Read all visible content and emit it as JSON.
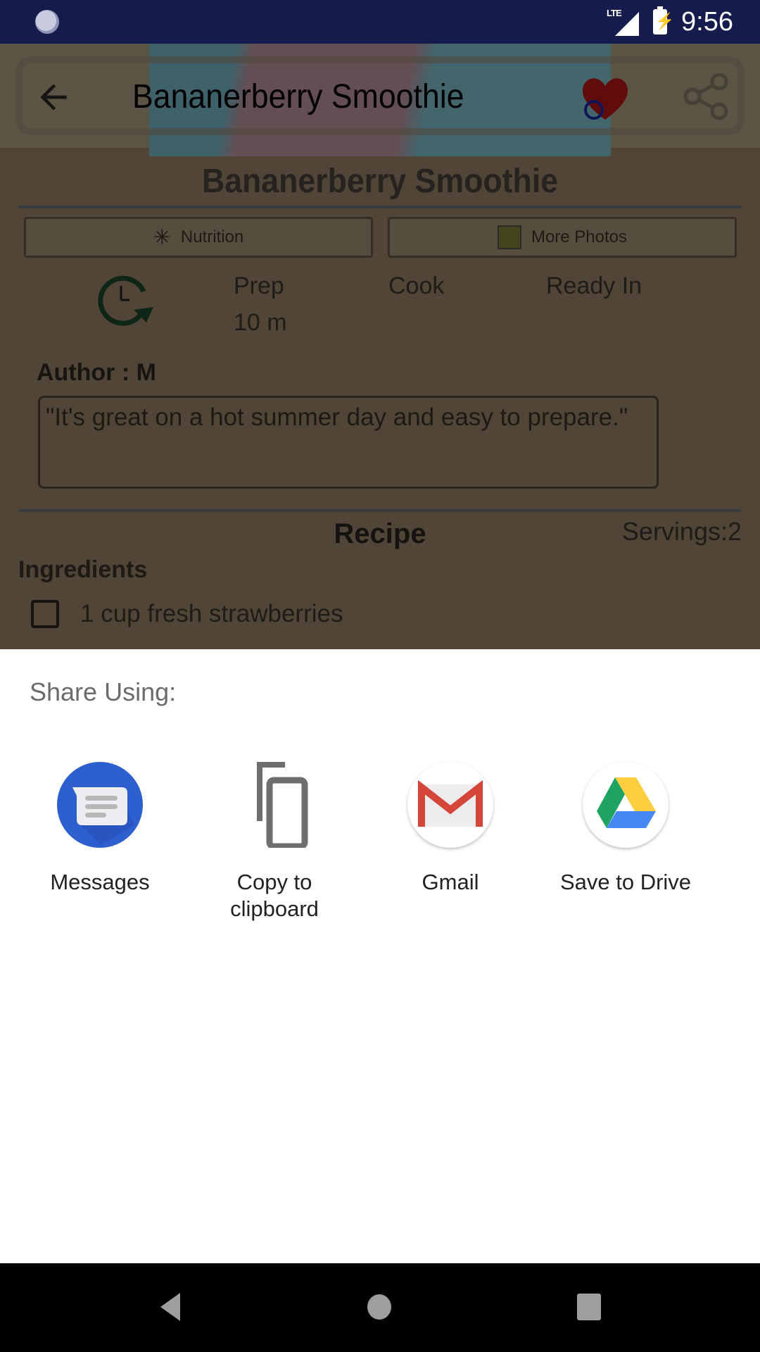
{
  "status_bar": {
    "network": "LTE",
    "time": "9:56",
    "icons": [
      "sync-loader-icon",
      "lte-signal-icon",
      "battery-charging-icon"
    ]
  },
  "toolbar": {
    "back_icon": "arrow-left-icon",
    "title": "Bananerberry Smoothie",
    "favorite_icon": "heart-icon",
    "share_icon": "share-icon"
  },
  "recipe": {
    "title": "Bananerberry Smoothie",
    "buttons": [
      {
        "label": "Nutrition",
        "icon": "nutrition-icon"
      },
      {
        "label": "More Photos",
        "icon": "photos-icon"
      }
    ],
    "times": [
      {
        "label": "Prep",
        "value": "10 m"
      },
      {
        "label": "Cook",
        "value": ""
      },
      {
        "label": "Ready In",
        "value": ""
      }
    ],
    "author": "Author : M",
    "quote": "\"It's great on a hot summer day and easy to prepare.\"",
    "section_title": "Recipe",
    "servings": "Servings:2",
    "ingredients_label": "Ingredients",
    "ingredients": [
      {
        "text": "1 cup fresh strawberries",
        "checked": false
      }
    ]
  },
  "share_sheet": {
    "title": "Share Using:",
    "targets": [
      {
        "label": "Messages",
        "icon": "messages-icon"
      },
      {
        "label": "Copy to clipboard",
        "icon": "copy-icon"
      },
      {
        "label": "Gmail",
        "icon": "gmail-icon"
      },
      {
        "label": "Save to Drive",
        "icon": "drive-icon"
      }
    ]
  },
  "nav_bar": {
    "buttons": [
      "back",
      "home",
      "recents"
    ]
  },
  "colors": {
    "status_bar": "#161b4d",
    "messages_blue": "#2e5fcf",
    "gmail_red": "#d44638",
    "drive_green": "#1ea362",
    "drive_yellow": "#ffcd40",
    "drive_blue": "#4688f4"
  }
}
